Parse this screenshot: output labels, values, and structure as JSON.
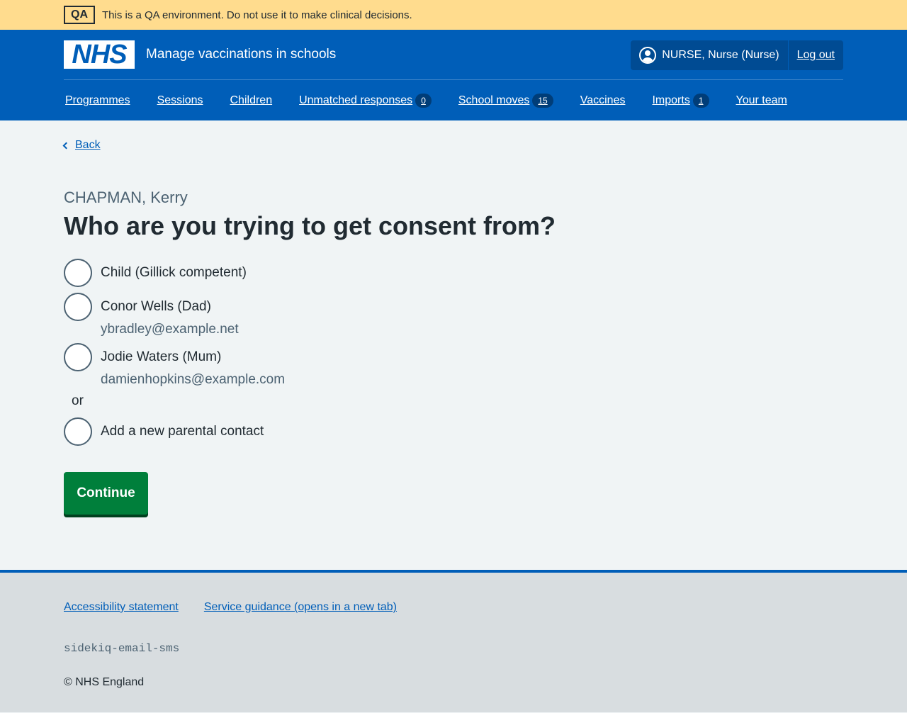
{
  "qa_banner": {
    "tag": "QA",
    "text": "This is a QA environment. Do not use it to make clinical decisions."
  },
  "header": {
    "logo_text": "NHS",
    "service_name": "Manage vaccinations in schools",
    "user": "NURSE, Nurse (Nurse)",
    "logout": "Log out"
  },
  "nav": {
    "items": [
      {
        "label": "Programmes"
      },
      {
        "label": "Sessions"
      },
      {
        "label": "Children"
      },
      {
        "label": "Unmatched responses",
        "count": "0"
      },
      {
        "label": "School moves",
        "count": "15"
      },
      {
        "label": "Vaccines"
      },
      {
        "label": "Imports",
        "count": "1"
      },
      {
        "label": "Your team"
      }
    ]
  },
  "main": {
    "back": "Back",
    "caption": "CHAPMAN, Kerry",
    "heading": "Who are you trying to get consent from?",
    "options": [
      {
        "label": "Child (Gillick competent)"
      },
      {
        "label": "Conor Wells (Dad)",
        "hint": "ybradley@example.net"
      },
      {
        "label": "Jodie Waters (Mum)",
        "hint": "damienhopkins@example.com"
      }
    ],
    "divider": "or",
    "new_contact": "Add a new parental contact",
    "continue": "Continue"
  },
  "footer": {
    "links": [
      "Accessibility statement",
      "Service guidance (opens in a new tab)"
    ],
    "env": "sidekiq-email-sms",
    "copyright": "© NHS England"
  },
  "colors": {
    "nhs_blue": "#005eb8",
    "qa_yellow": "#ffdc8e",
    "button_green": "#007f3b"
  }
}
